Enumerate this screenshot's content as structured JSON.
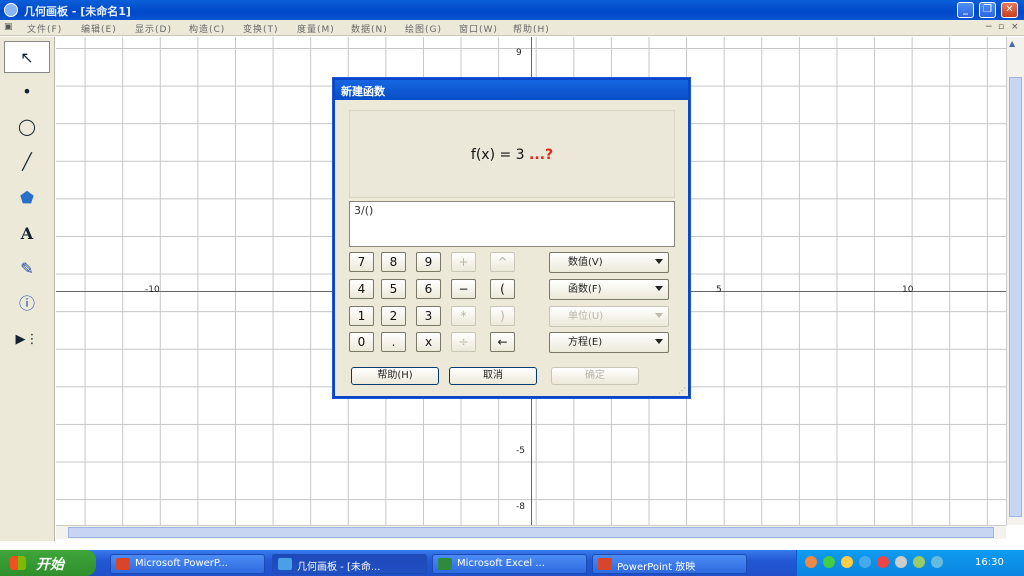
{
  "window": {
    "title": "几何画板 - [未命名1]"
  },
  "menu": [
    "文件(F)",
    "编辑(E)",
    "显示(D)",
    "构造(C)",
    "变换(T)",
    "度量(M)",
    "数据(N)",
    "绘图(G)",
    "窗口(W)",
    "帮助(H)"
  ],
  "toolbox": [
    {
      "icon": "arrow-select-icon",
      "glyph": "↖"
    },
    {
      "icon": "point-tool-icon",
      "glyph": "•"
    },
    {
      "icon": "compass-tool-icon",
      "glyph": "◯"
    },
    {
      "icon": "line-tool-icon",
      "glyph": "╱"
    },
    {
      "icon": "polygon-tool-icon",
      "glyph": "⬟"
    },
    {
      "icon": "text-tool-icon",
      "glyph": "A"
    },
    {
      "icon": "marker-tool-icon",
      "glyph": "✎"
    },
    {
      "icon": "info-tool-icon",
      "glyph": "ⓘ"
    },
    {
      "icon": "custom-tool-icon",
      "glyph": "▶⋮"
    }
  ],
  "axis": {
    "x_neg": "-10",
    "x_pos5": "5",
    "x_pos10": "10",
    "y_top": "9",
    "y_m5": "-5",
    "y_m8": "-8"
  },
  "dialog": {
    "title": "新建函数",
    "preview_fx": "f(x) = 3",
    "preview_q": "...?",
    "expression": "3/()",
    "keys": [
      [
        "7",
        "8",
        "9",
        "+",
        "^"
      ],
      [
        "4",
        "5",
        "6",
        "−",
        "("
      ],
      [
        "1",
        "2",
        "3",
        "*",
        ")"
      ],
      [
        "0",
        ".",
        "x",
        "÷",
        "←"
      ]
    ],
    "keys_disabled": [
      [
        false,
        false,
        false,
        true,
        true
      ],
      [
        false,
        false,
        false,
        false,
        false
      ],
      [
        false,
        false,
        false,
        true,
        true
      ],
      [
        false,
        false,
        false,
        true,
        false
      ]
    ],
    "dropdowns": [
      {
        "label": "数值(V)",
        "disabled": false
      },
      {
        "label": "函数(F)",
        "disabled": false
      },
      {
        "label": "单位(U)",
        "disabled": true
      },
      {
        "label": "方程(E)",
        "disabled": false
      }
    ],
    "help_label": "帮助(H)",
    "cancel_label": "取消",
    "ok_label": "确定"
  },
  "taskbar": {
    "start_label": "开始",
    "tasks": [
      {
        "label": "Microsoft PowerP...",
        "color": "#d9452b"
      },
      {
        "label": "几何画板 - [未命...",
        "color": "#4aa0e6"
      },
      {
        "label": "Microsoft Excel ...",
        "color": "#2e8b3d"
      },
      {
        "label": "PowerPoint 放映",
        "color": "#d9452b"
      }
    ],
    "clock": "16:30"
  }
}
